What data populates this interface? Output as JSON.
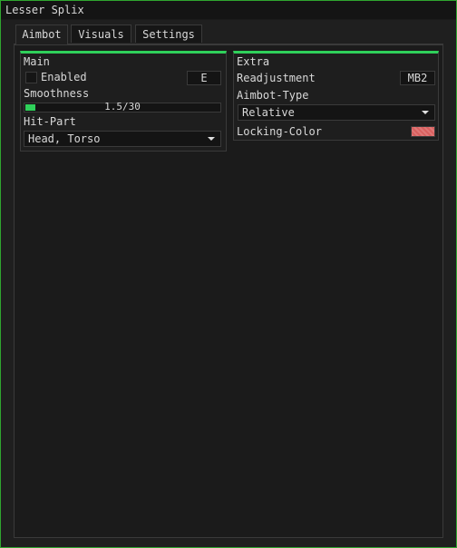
{
  "window": {
    "title": "Lesser Splix"
  },
  "tabs": [
    {
      "label": "Aimbot",
      "active": true
    },
    {
      "label": "Visuals",
      "active": false
    },
    {
      "label": "Settings",
      "active": false
    }
  ],
  "main": {
    "title": "Main",
    "enabled": {
      "label": "Enabled",
      "checked": false,
      "key": "E"
    },
    "smoothness": {
      "label": "Smoothness",
      "value": 1.5,
      "max": 30,
      "display": "1.5/30"
    },
    "hit_part": {
      "label": "Hit-Part",
      "value": "Head, Torso"
    }
  },
  "extra": {
    "title": "Extra",
    "readjustment": {
      "label": "Readjustment",
      "key": "MB2"
    },
    "aimbot_type": {
      "label": "Aimbot-Type",
      "value": "Relative"
    },
    "locking_color": {
      "label": "Locking-Color",
      "color": "#d9605f"
    }
  },
  "colors": {
    "accent": "#2fd05a",
    "border": "#2fa52f"
  }
}
